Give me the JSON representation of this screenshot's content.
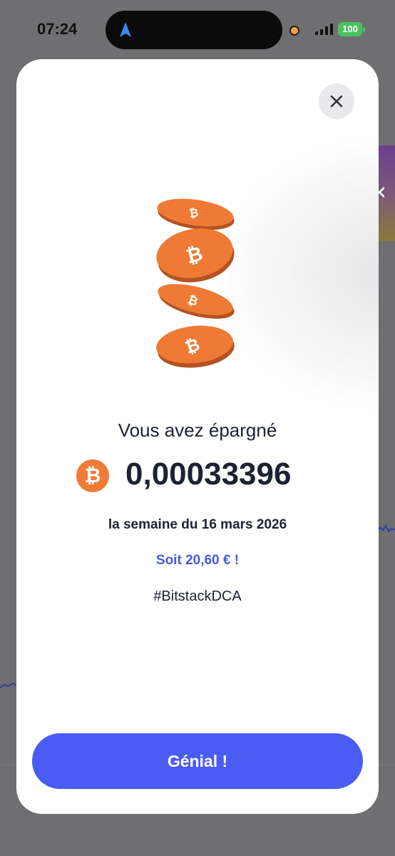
{
  "status_bar": {
    "time": "07:24",
    "battery": "100",
    "accent_battery": "#4cc25f",
    "location_icon": "navigation-arrow-icon"
  },
  "modal": {
    "close_icon": "close-icon",
    "illustration": "bitcoin-coins-stack",
    "title": "Vous avez épargné",
    "currency_symbol": "₿",
    "amount": "0,00033396",
    "period": "la semaine du 16 mars 2026",
    "fiat_equivalent": "Soit 20,60 € !",
    "hashtag": "#BitstackDCA",
    "cta_label": "Génial !",
    "colors": {
      "primary": "#4a5cf3",
      "bitcoin": "#ef7b36",
      "text": "#1d2233",
      "link": "#4a5bd9"
    }
  },
  "side_panel": {
    "handle_icon": "chevron-left-icon"
  }
}
